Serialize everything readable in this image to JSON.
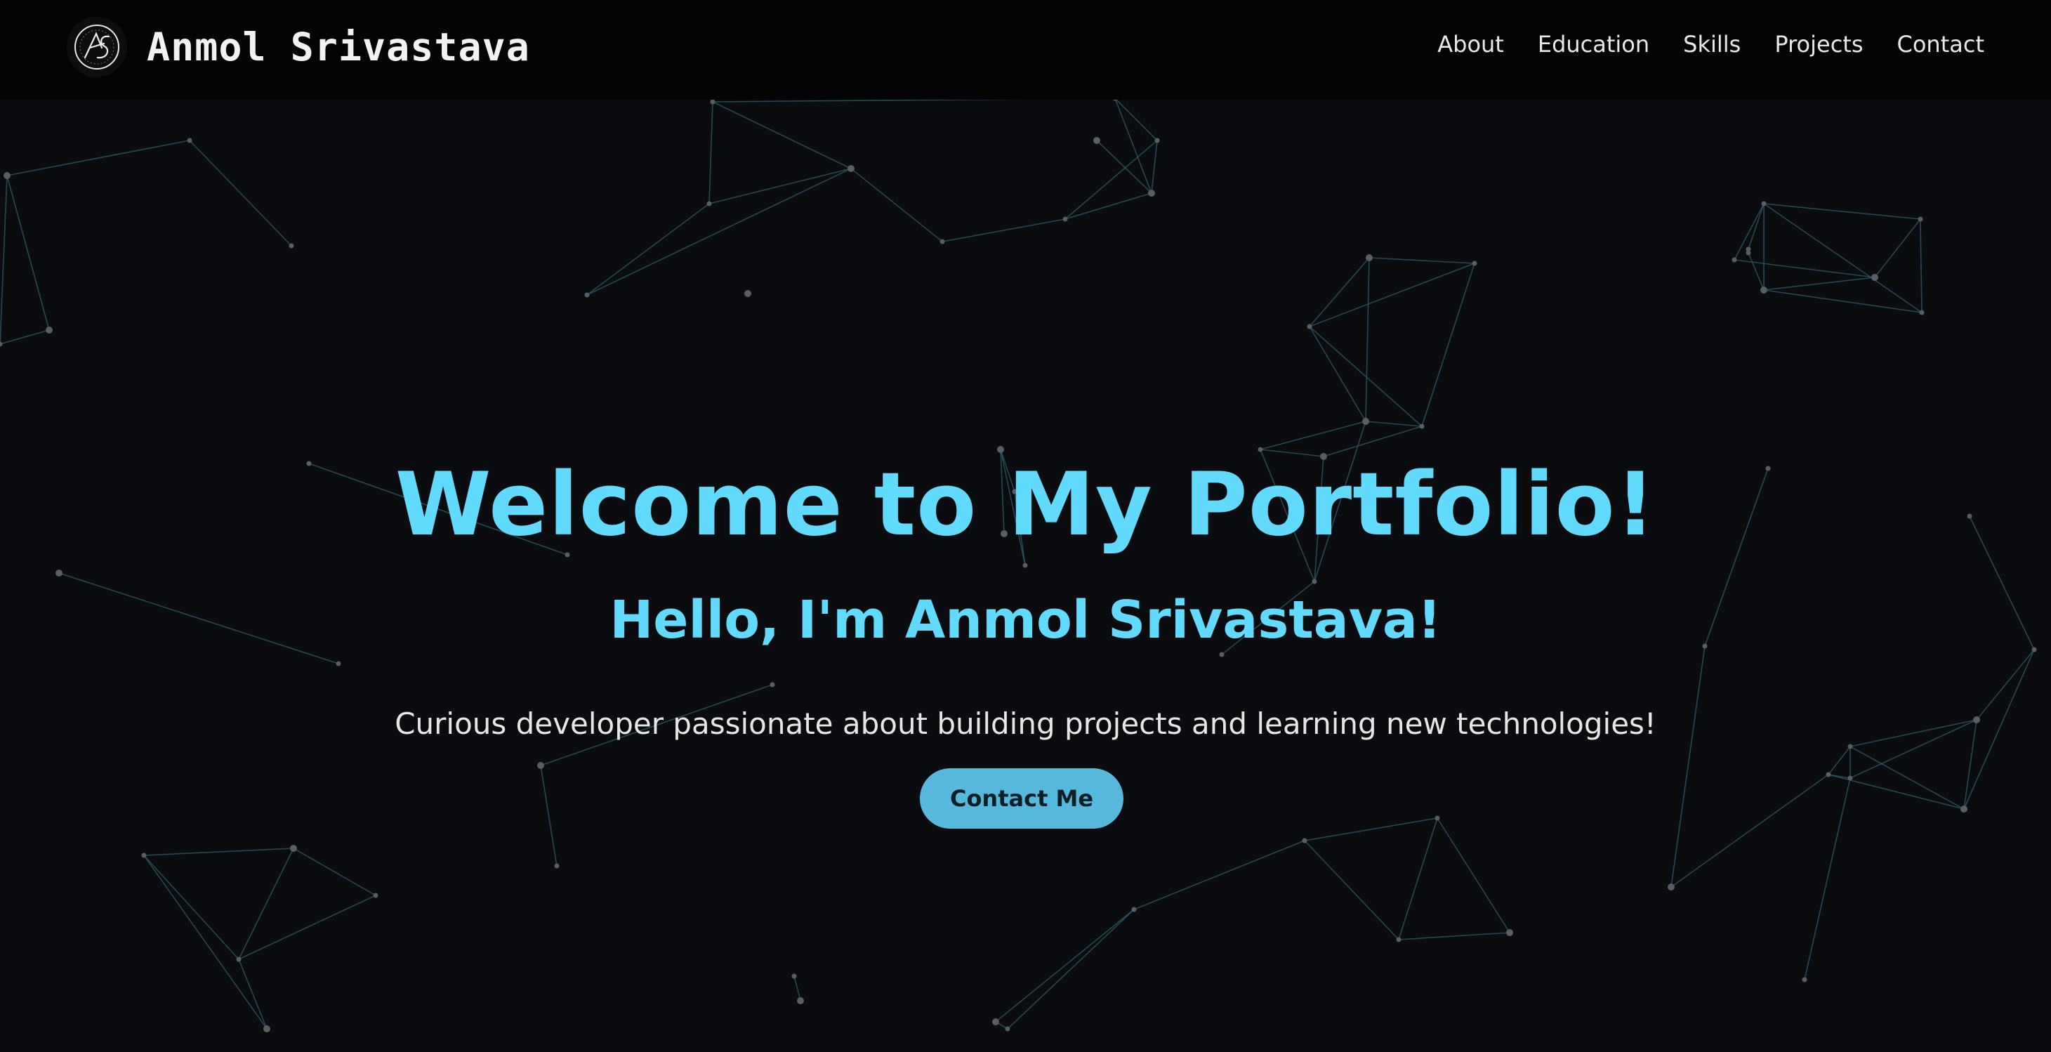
{
  "header": {
    "brand_name": "Anmol Srivastava",
    "logo_icon": "initials-logo-icon",
    "nav": [
      {
        "label": "About"
      },
      {
        "label": "Education"
      },
      {
        "label": "Skills"
      },
      {
        "label": "Projects"
      },
      {
        "label": "Contact"
      }
    ]
  },
  "hero": {
    "title": "Welcome to My Portfolio!",
    "subtitle": "Hello, I'm Anmol Srivastava!",
    "tagline": "Curious developer passionate about building projects and learning new technologies!",
    "cta_label": "Contact Me"
  },
  "colors": {
    "background": "#0b0c0f",
    "navbar": "#040404",
    "accent": "#61dafb",
    "button": "#56b9dc",
    "network_line": "#2e5d6b",
    "network_node": "#5a5e63"
  }
}
